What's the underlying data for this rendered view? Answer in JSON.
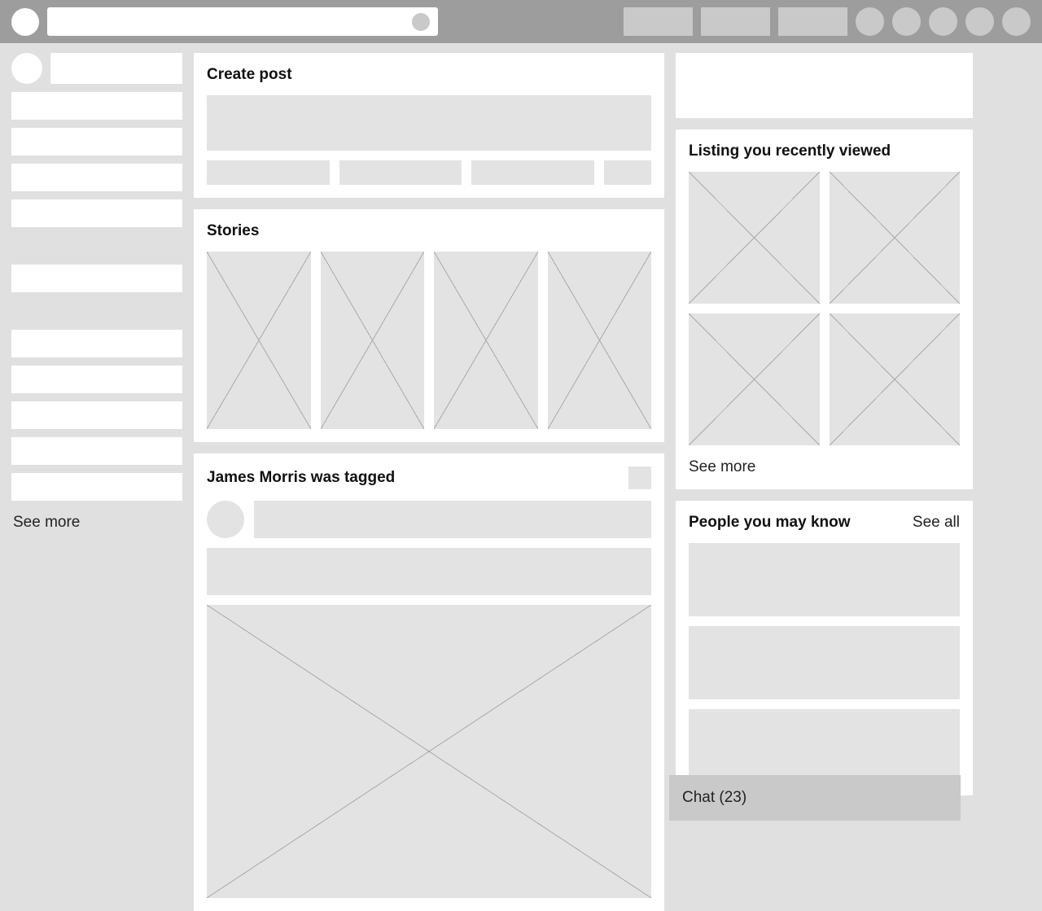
{
  "topbar": {
    "search_placeholder": ""
  },
  "sidebar": {
    "see_more": "See more"
  },
  "create_post": {
    "title": "Create post"
  },
  "stories": {
    "title": "Stories"
  },
  "feed_post": {
    "headline": "James Morris was tagged"
  },
  "listings": {
    "title": "Listing you recently viewed",
    "see_more": "See more"
  },
  "people": {
    "title": "People you may know",
    "see_all": "See all"
  },
  "chat": {
    "label": "Chat (23)"
  }
}
